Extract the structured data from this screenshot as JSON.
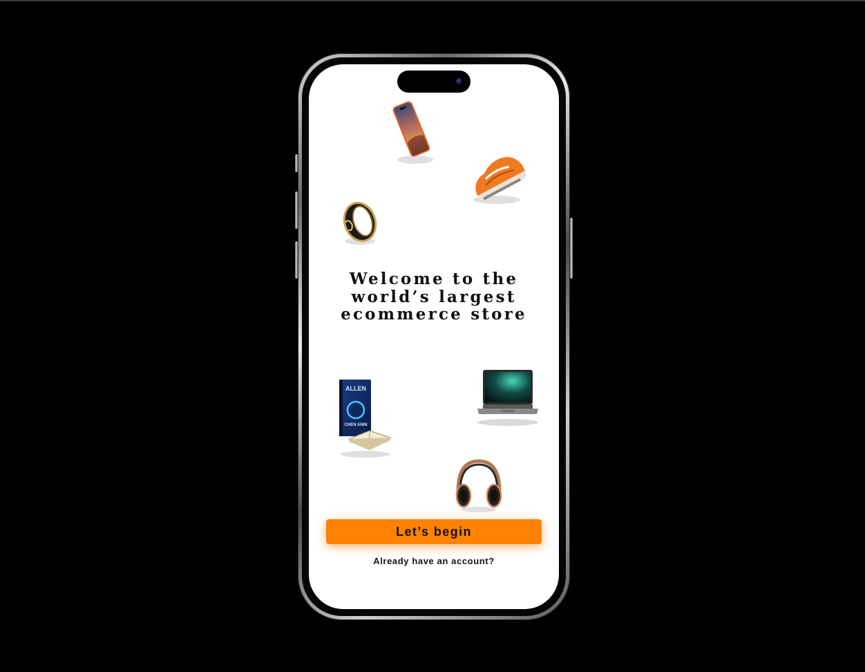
{
  "welcome": {
    "headline_lines": [
      "Welcome to the",
      "world’s largest",
      "ecommerce store"
    ]
  },
  "actions": {
    "begin_label": "Let’s begin",
    "login_label": "Already have an account?"
  },
  "products": [
    {
      "icon": "smartphone-icon"
    },
    {
      "icon": "sneaker-icon"
    },
    {
      "icon": "ring-icon"
    },
    {
      "icon": "book-icon"
    },
    {
      "icon": "laptop-icon"
    },
    {
      "icon": "headphones-icon"
    }
  ],
  "book_cover": {
    "title": "ALLEN",
    "author": "CHEN ANIN"
  },
  "colors": {
    "accent": "#ff8200",
    "background": "#000000",
    "screen": "#ffffff",
    "text": "#111111"
  }
}
